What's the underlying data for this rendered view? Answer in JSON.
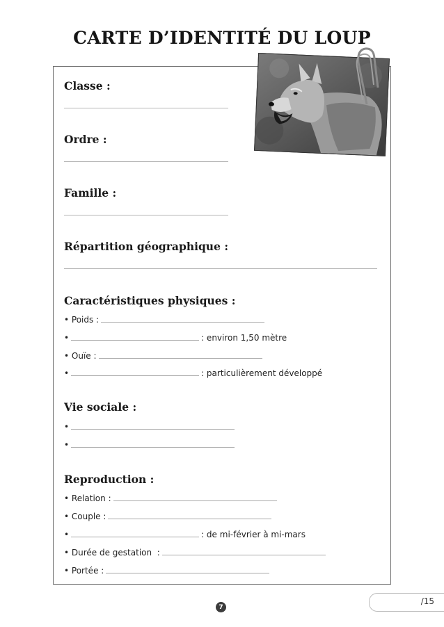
{
  "title": "CARTE D’IDENTITÉ DU LOUP",
  "sections": {
    "classe": "Classe :",
    "ordre": "Ordre :",
    "famille": "Famille :",
    "repartition": "Répartition géographique :",
    "caracteristiques": "Caractéristiques physiques :",
    "vie_sociale": "Vie sociale :",
    "reproduction": "Reproduction :"
  },
  "physiques": {
    "poids": "• Poids :",
    "taille_bullet": "•",
    "taille_suffix": ": environ 1,50 mètre",
    "ouie": "• Ouïe :",
    "sens_bullet": "•",
    "sens_suffix": ": particulièrement développé"
  },
  "vie_sociale": {
    "item1": "•",
    "item2": "•"
  },
  "reproduction": {
    "relation": "• Relation :",
    "couple": "• Couple :",
    "periode_bullet": "•",
    "periode_suffix": ": de mi-février à mi-mars",
    "gestation": "• Durée de gestation  :",
    "portee": "• Portée :"
  },
  "footer": {
    "page_number": "7",
    "score": "/15"
  },
  "icons": {
    "photo": "wolf-photo",
    "clip": "paperclip-icon"
  }
}
